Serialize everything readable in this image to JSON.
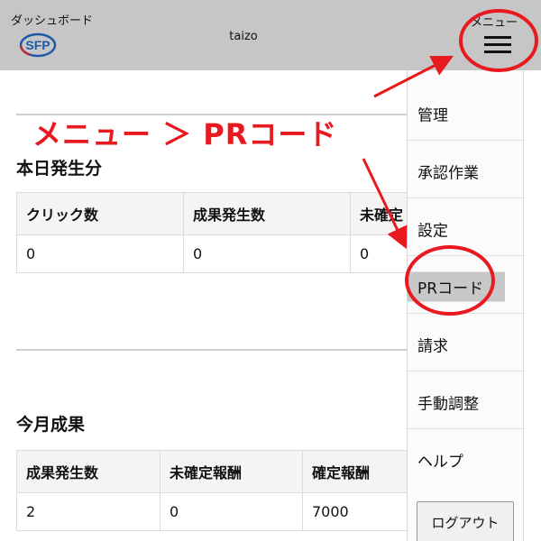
{
  "header": {
    "dashboard_title": "ダッシュボード",
    "logo_text": "SFP",
    "username": "taizo",
    "menu_label": "メニュー"
  },
  "annotation": {
    "text": "メニュー ＞ PRコード",
    "color": "#e8191f"
  },
  "today": {
    "title": "本日発生分",
    "columns": [
      "クリック数",
      "成果発生数",
      "未確定"
    ],
    "rows": [
      [
        "0",
        "0",
        "0"
      ]
    ]
  },
  "month": {
    "title": "今月成果",
    "columns": [
      "成果発生数",
      "未確定報酬",
      "確定報酬"
    ],
    "rows": [
      [
        "2",
        "0",
        "7000"
      ]
    ]
  },
  "sidebar": {
    "items": [
      {
        "label": "管理"
      },
      {
        "label": "承認作業"
      },
      {
        "label": "設定"
      },
      {
        "label": "PRコード"
      },
      {
        "label": "請求"
      },
      {
        "label": "手動調整"
      },
      {
        "label": "ヘルプ"
      }
    ],
    "selected_index": 3,
    "logout_label": "ログアウト"
  },
  "colors": {
    "header_bg": "#c6c6c6",
    "accent_red": "#e8191f",
    "selected_bg": "#c8c8c8",
    "logo_blue": "#1f5aa8"
  }
}
